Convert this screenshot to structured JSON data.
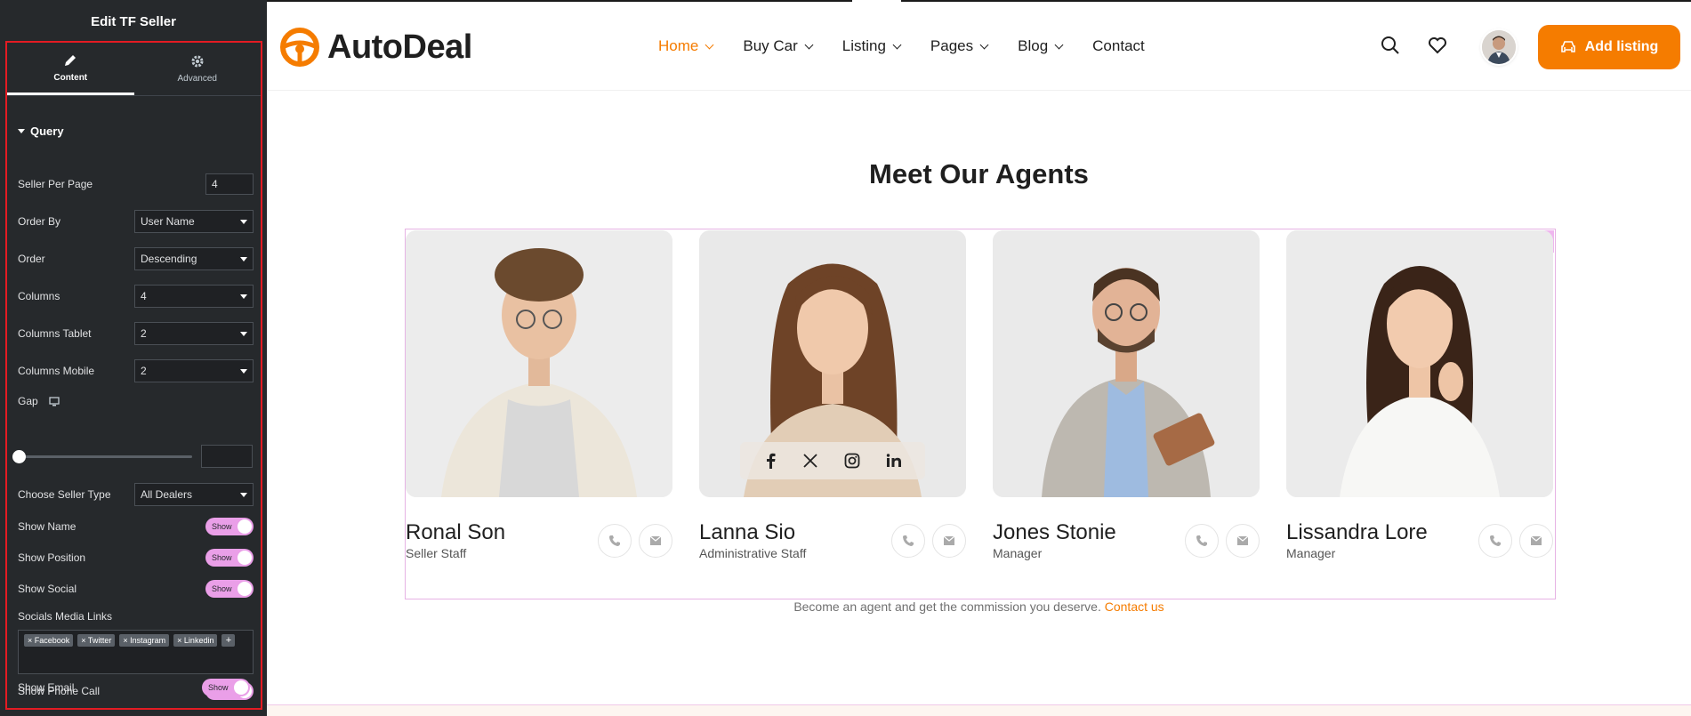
{
  "editor": {
    "title": "Edit TF Seller",
    "tabs": [
      {
        "label": "Content",
        "icon": "pencil-icon"
      },
      {
        "label": "Advanced",
        "icon": "gear-icon"
      }
    ],
    "section_title": "Query",
    "seller_per_page": {
      "label": "Seller Per Page",
      "value": "4"
    },
    "order_by": {
      "label": "Order By",
      "value": "User Name"
    },
    "order": {
      "label": "Order",
      "value": "Descending"
    },
    "columns": {
      "label": "Columns",
      "value": "4"
    },
    "columns_tablet": {
      "label": "Columns Tablet",
      "value": "2"
    },
    "columns_mobile": {
      "label": "Columns Mobile",
      "value": "2"
    },
    "gap": {
      "label": "Gap"
    },
    "seller_type": {
      "label": "Choose Seller Type",
      "value": "All Dealers"
    },
    "show_name": {
      "label": "Show Name",
      "state": "Show"
    },
    "show_position": {
      "label": "Show Position",
      "state": "Show"
    },
    "show_social": {
      "label": "Show Social",
      "state": "Show"
    },
    "socials_label": "Socials Media Links",
    "socials_tags": [
      "× Facebook",
      "× Twitter",
      "× Instagram",
      "× Linkedin"
    ],
    "add_tag": "+",
    "show_phone": {
      "label": "Show Phone Call",
      "state": "Show"
    },
    "show_email": {
      "label": "Show Email",
      "state": "Show"
    },
    "collapse_arrow": "‹"
  },
  "site": {
    "logo": "AutoDeal",
    "nav": [
      "Home",
      "Buy Car",
      "Listing",
      "Pages",
      "Blog",
      "Contact"
    ],
    "add_listing": "Add listing",
    "heading": "Meet Our Agents",
    "agents": [
      {
        "name": "Ronal Son",
        "role": "Seller Staff"
      },
      {
        "name": "Lanna Sio",
        "role": "Administrative Staff"
      },
      {
        "name": "Jones Stonie",
        "role": "Manager"
      },
      {
        "name": "Lissandra Lore",
        "role": "Manager"
      }
    ],
    "footer_text": "Become an agent and get the commission you deserve.",
    "footer_link": "Contact us"
  },
  "colors": {
    "accent": "#f57c00",
    "editor_bg": "#26292c",
    "toggle": "#ea9fe8",
    "highlight": "#e31b23"
  }
}
